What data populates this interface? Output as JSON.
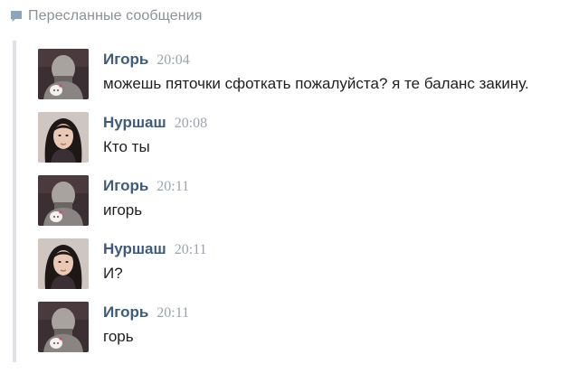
{
  "header": {
    "icon": "speech-bubble-icon",
    "title": "Пересланные сообщения"
  },
  "colors": {
    "accent_author": "#3f5b79",
    "time": "#9ca4ad",
    "header_text": "#8a9199",
    "thread_line": "#dfe3e8"
  },
  "messages": [
    {
      "author": "Игорь",
      "time": "20:04",
      "text": "можешь пяточки сфоткать пожалуйста? я те баланс закину."
    },
    {
      "author": "Нуршаш",
      "time": "20:08",
      "text": "Кто ты"
    },
    {
      "author": "Игорь",
      "time": "20:11",
      "text": "игорь"
    },
    {
      "author": "Нуршаш",
      "time": "20:11",
      "text": "И?"
    },
    {
      "author": "Игорь",
      "time": "20:11",
      "text": "горь"
    }
  ]
}
